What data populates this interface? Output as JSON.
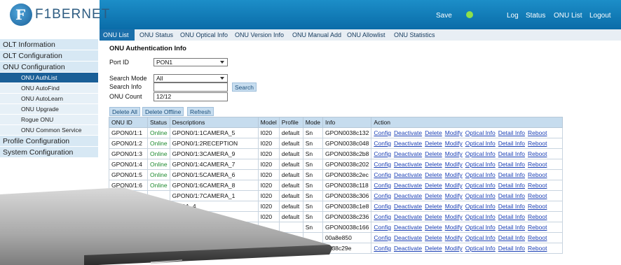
{
  "brand": {
    "logo_text": "F1BERNET"
  },
  "top_nav": {
    "save": "Save",
    "log": "Log",
    "status": "Status",
    "onu_list": "ONU List",
    "logout": "Logout"
  },
  "tabs": [
    "ONU List",
    "ONU Status",
    "ONU Optical Info",
    "ONU Version Info",
    "ONU Manual Add",
    "ONU Allowlist",
    "ONU Statistics"
  ],
  "sidebar": {
    "items": [
      "OLT Information",
      "OLT Configuration",
      "ONU Configuration"
    ],
    "sub_items": [
      "ONU AuthList",
      "ONU AutoFind",
      "ONU AutoLearn",
      "ONU Upgrade",
      "Rogue ONU",
      "ONU Common Service"
    ],
    "bottom_items": [
      "Profile Configuration",
      "System Configuration"
    ]
  },
  "main": {
    "section_title": "ONU Authentication Info",
    "port_label": "Port ID",
    "port_value": "PON1",
    "search_mode_label": "Search Mode",
    "search_mode_value": "All",
    "search_info_label": "Search Info",
    "search_info_value": "",
    "search_button": "Search",
    "onu_count_label": "ONU Count",
    "onu_count_value": "12/12",
    "delete_all": "Delete All",
    "delete_offline": "Delete Offline",
    "refresh": "Refresh"
  },
  "table": {
    "headers": [
      "ONU ID",
      "Status",
      "Descriptions",
      "Model",
      "Profile",
      "Mode",
      "Info",
      "Action"
    ],
    "actions": [
      "Config",
      "Deactivate",
      "Delete",
      "Modify",
      "Optical Info",
      "Detail Info",
      "Reboot"
    ],
    "rows": [
      [
        "GPON0/1:1",
        "Online",
        "GPON0/1:1CAMERA_5",
        "I020",
        "default",
        "Sn",
        "GPON0038c132"
      ],
      [
        "GPON0/1:2",
        "Online",
        "GPON0/1:2RECEPTION",
        "I020",
        "default",
        "Sn",
        "GPON0038c048"
      ],
      [
        "GPON0/1:3",
        "Online",
        "GPON0/1:3CAMERA_9",
        "I020",
        "default",
        "Sn",
        "GPON0038c2b8"
      ],
      [
        "GPON0/1:4",
        "Online",
        "GPON0/1:4CAMERA_7",
        "I020",
        "default",
        "Sn",
        "GPON0038c202"
      ],
      [
        "GPON0/1:5",
        "Online",
        "GPON0/1:5CAMERA_6",
        "I020",
        "default",
        "Sn",
        "GPON0038c2ec"
      ],
      [
        "GPON0/1:6",
        "Online",
        "GPON0/1:6CAMERA_8",
        "I020",
        "default",
        "Sn",
        "GPON0038c118"
      ],
      [
        "",
        "",
        "GPON0/1:7CAMERA_1",
        "I020",
        "default",
        "Sn",
        "GPON0038c306"
      ],
      [
        "",
        "",
        "MERA_4",
        "I020",
        "default",
        "Sn",
        "GPON0038c1e8"
      ],
      [
        "",
        "",
        "",
        "I020",
        "default",
        "Sn",
        "GPON0038c236"
      ],
      [
        "",
        "",
        "",
        "",
        "",
        "Sn",
        "GPON0038c166"
      ],
      [
        "",
        "",
        "",
        "",
        "",
        "",
        "00a8e850"
      ],
      [
        "",
        "",
        "",
        "",
        "",
        "",
        "0038c29e"
      ]
    ]
  },
  "colors": {
    "header": "#0f7bb8",
    "sidebar_active": "#1a5f97",
    "online": "#1d8a2e",
    "link": "#1a3fb5",
    "status_dot": "#8ee04a"
  }
}
